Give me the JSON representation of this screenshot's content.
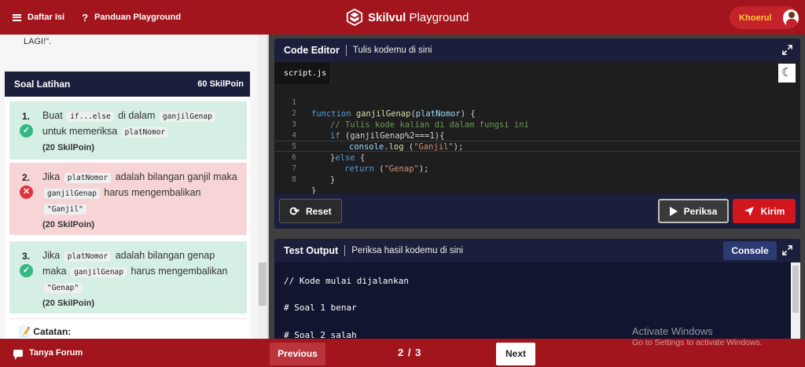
{
  "topbar": {
    "menu_label": "Daftar Isi",
    "guide_label": "Panduan Playground",
    "brand_bold": "Skilvul",
    "brand_rest": "Playground",
    "user_name": "Khoerul"
  },
  "left_panel": {
    "top_text": "LAGI!\".",
    "soal_title": "Soal Latihan",
    "soal_poin": "60 SkilPoin",
    "questions": [
      {
        "num": "1.",
        "status": "correct",
        "parts": [
          "Buat",
          "if...else",
          "di dalam",
          "ganjilGenap",
          "untuk memeriksa",
          "platNomor"
        ],
        "poin": "(20 SkilPoin)"
      },
      {
        "num": "2.",
        "status": "wrong",
        "parts": [
          "Jika",
          "platNomor",
          "adalah bilangan ganjil maka",
          "ganjilGenap",
          "harus mengembalikan",
          "\"Ganjil\""
        ],
        "poin": "(20 SkilPoin)"
      },
      {
        "num": "3.",
        "status": "correct",
        "parts": [
          "Jika",
          "platNomor",
          "adalah bilangan genap maka",
          "ganjilGenap",
          "harus mengembalikan",
          "\"Genap\""
        ],
        "poin": "(20 SkilPoin)"
      }
    ],
    "catatan": "Catatan:"
  },
  "editor": {
    "title": "Code Editor",
    "subtitle": "Tulis kodemu di sini",
    "file_name": "script.js",
    "line_numbers": [
      "1",
      "2",
      "3",
      "4",
      "5",
      "6",
      "7",
      "8"
    ],
    "code": {
      "l1_kw": "function",
      "l1_fn": "ganjilGenap",
      "l1_open": "(",
      "l1_param": "platNomor",
      "l1_close": ") {",
      "l2_comment": "// Tulis kode kalian di dalam fungsi ini",
      "l3_kw": "if",
      "l3_rest": " (ganjilGenap%2===1){",
      "l4_obj": "console",
      "l4_fn": "log",
      "l4_str": "\"Ganjil\"",
      "l5_brace": "}",
      "l5_kw": "else",
      "l5_rest": " {",
      "l6_kw": "return",
      "l6_str": "\"Genap\"",
      "l7": "}",
      "l8": "}"
    },
    "reset_label": "Reset",
    "periksa_label": "Periksa",
    "kirim_label": "Kirim"
  },
  "output": {
    "title": "Test Output",
    "subtitle": "Periksa hasil kodemu di sini",
    "console_label": "Console",
    "lines": [
      "// Kode mulai dijalankan",
      "# Soal 1 benar",
      "# Soal 2 salah"
    ]
  },
  "bottombar": {
    "forum_label": "Tanya Forum",
    "prev_label": "Previous",
    "page": "2 / 3",
    "next_label": "Next"
  },
  "watermark": {
    "line1": "Activate Windows",
    "line2": "Go to Settings to activate Windows."
  }
}
